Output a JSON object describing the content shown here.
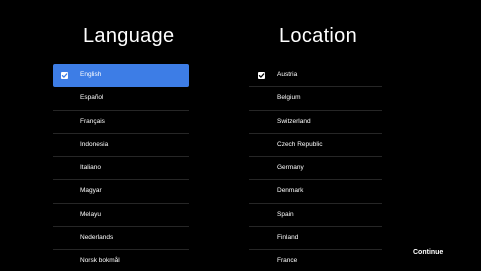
{
  "language": {
    "title": "Language",
    "items": [
      {
        "label": "English",
        "checked": true,
        "focused": true
      },
      {
        "label": "Español"
      },
      {
        "label": "Français"
      },
      {
        "label": "Indonesia"
      },
      {
        "label": "Italiano"
      },
      {
        "label": "Magyar"
      },
      {
        "label": "Melayu"
      },
      {
        "label": "Nederlands"
      },
      {
        "label": "Norsk bokmål"
      }
    ]
  },
  "location": {
    "title": "Location",
    "items": [
      {
        "label": "Austria",
        "checked": true
      },
      {
        "label": "Belgium"
      },
      {
        "label": "Switzerland"
      },
      {
        "label": "Czech Republic"
      },
      {
        "label": "Germany"
      },
      {
        "label": "Denmark"
      },
      {
        "label": "Spain"
      },
      {
        "label": "Finland"
      },
      {
        "label": "France"
      }
    ]
  },
  "actions": {
    "continue_label": "Continue"
  },
  "colors": {
    "background": "#000000",
    "focus_highlight": "#3d7de6",
    "text": "#ffffff",
    "divider": "#262626"
  },
  "icons": {
    "checkbox": "checkbox-checked-icon"
  }
}
